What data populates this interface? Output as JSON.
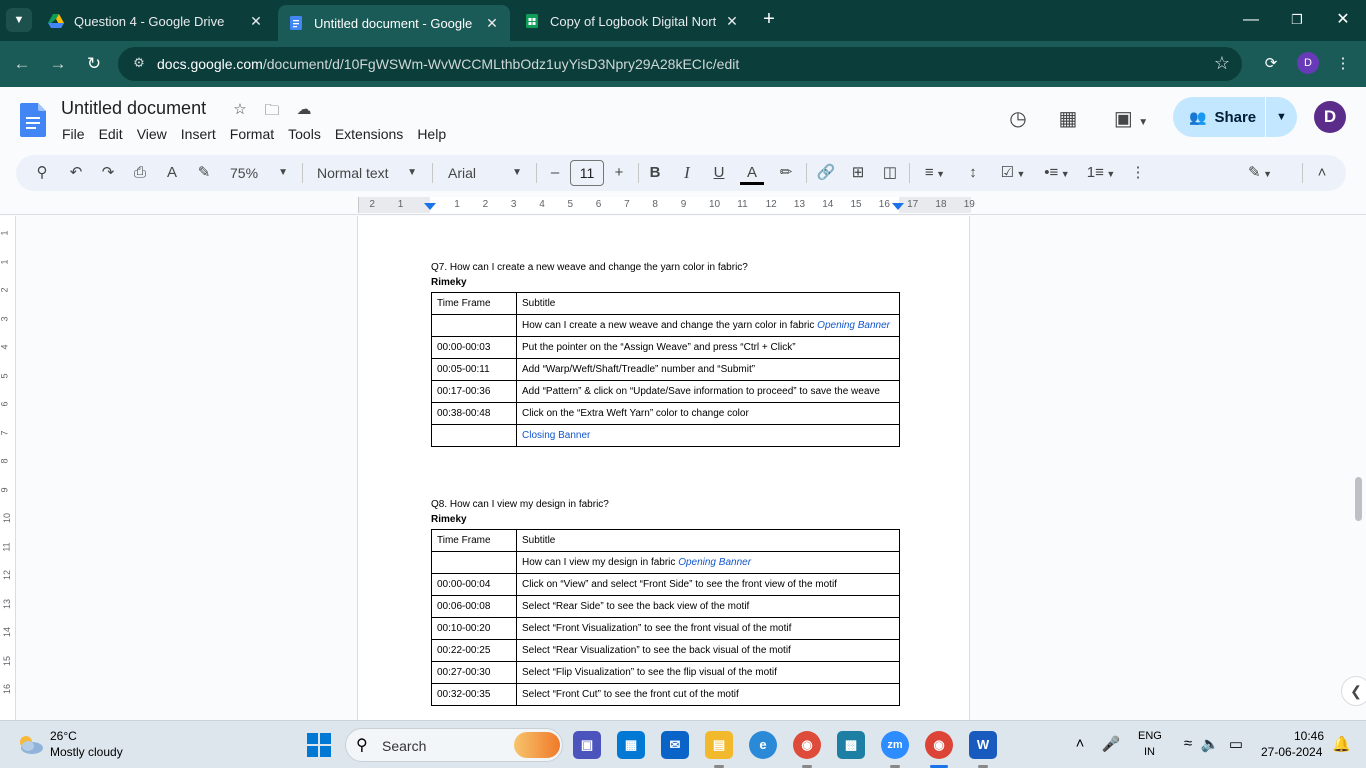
{
  "browser": {
    "tabs": [
      {
        "title": "Question 4 - Google Drive",
        "active": false
      },
      {
        "title": "Untitled document - Google Do",
        "active": true
      },
      {
        "title": "Copy of Logbook Digital North",
        "active": false
      }
    ],
    "url_host": "docs.google.com",
    "url_path": "/document/d/10FgWSWm-WvWCCMLthbOdz1uyYisD3Npry29A28kECIc/edit",
    "profile_initial": "D"
  },
  "docs": {
    "title": "Untitled document",
    "menu": [
      "File",
      "Edit",
      "View",
      "Insert",
      "Format",
      "Tools",
      "Extensions",
      "Help"
    ],
    "share_label": "Share",
    "avatar_initial": "D",
    "toolbar": {
      "zoom": "75%",
      "style": "Normal text",
      "font": "Arial",
      "font_size": "11"
    },
    "ruler_numbers": [
      "2",
      "1",
      "1",
      "2",
      "3",
      "4",
      "5",
      "6",
      "7",
      "8",
      "9",
      "10",
      "11",
      "12",
      "13",
      "14",
      "15",
      "16",
      "17",
      "18",
      "19"
    ],
    "vruler_numbers": [
      "1",
      "1",
      "2",
      "3",
      "4",
      "5",
      "6",
      "7",
      "8",
      "9",
      "10",
      "11",
      "12",
      "13",
      "14",
      "15",
      "16"
    ]
  },
  "content": {
    "q7": {
      "question": "Q7. How can I create a new weave and change the yarn color in fabric?",
      "sub": "Rimeky",
      "header": {
        "tf": "Time Frame",
        "sub": "Subtitle"
      },
      "rows": [
        {
          "tf": "",
          "text": "How can I create a new weave and change the yarn color in fabric",
          "link": "Opening Banner"
        },
        {
          "tf": "00:00-00:03",
          "text": "Put the pointer on the “Assign Weave” and press “Ctrl + Click”"
        },
        {
          "tf": "00:05-00:11",
          "text": "Add “Warp/Weft/Shaft/Treadle” number and “Submit”"
        },
        {
          "tf": "00:17-00:36",
          "text": "Add “Pattern” & click on “Update/Save information to proceed” to save the weave"
        },
        {
          "tf": "00:38-00:48",
          "text": "Click on the “Extra Weft Yarn” color to change color"
        },
        {
          "tf": "",
          "link_only": "Closing Banner"
        }
      ]
    },
    "q8": {
      "question": "Q8. How can I view my design in fabric?",
      "sub": "Rimeky",
      "header": {
        "tf": "Time Frame",
        "sub": "Subtitle"
      },
      "rows": [
        {
          "tf": "",
          "text": "How can I view my design in fabric",
          "link": "Opening Banner"
        },
        {
          "tf": "00:00-00:04",
          "text": "Click on “View” and select “Front Side” to see the front view of the motif"
        },
        {
          "tf": "00:06-00:08",
          "text": "Select “Rear Side” to see the back view of the motif"
        },
        {
          "tf": "00:10-00:20",
          "text": "Select “Front Visualization” to see the front visual of the motif"
        },
        {
          "tf": "00:22-00:25",
          "text": "Select “Rear Visualization” to see the back visual of the motif"
        },
        {
          "tf": "00:27-00:30",
          "text": "Select “Flip Visualization” to see the flip visual of the motif"
        },
        {
          "tf": "00:32-00:35",
          "text": "Select “Front Cut” to see the front cut of the motif"
        }
      ]
    }
  },
  "taskbar": {
    "weather_temp": "26°C",
    "weather_desc": "Mostly cloudy",
    "search_placeholder": "Search",
    "lang_line1": "ENG",
    "lang_line2": "IN",
    "time": "10:46",
    "date": "27-06-2024"
  },
  "colors": {
    "chrome_dark": "#0b3d3a",
    "chrome_toolbar": "#1a5a57",
    "share_bg": "#c2e7ff",
    "link_blue": "#1155cc"
  }
}
